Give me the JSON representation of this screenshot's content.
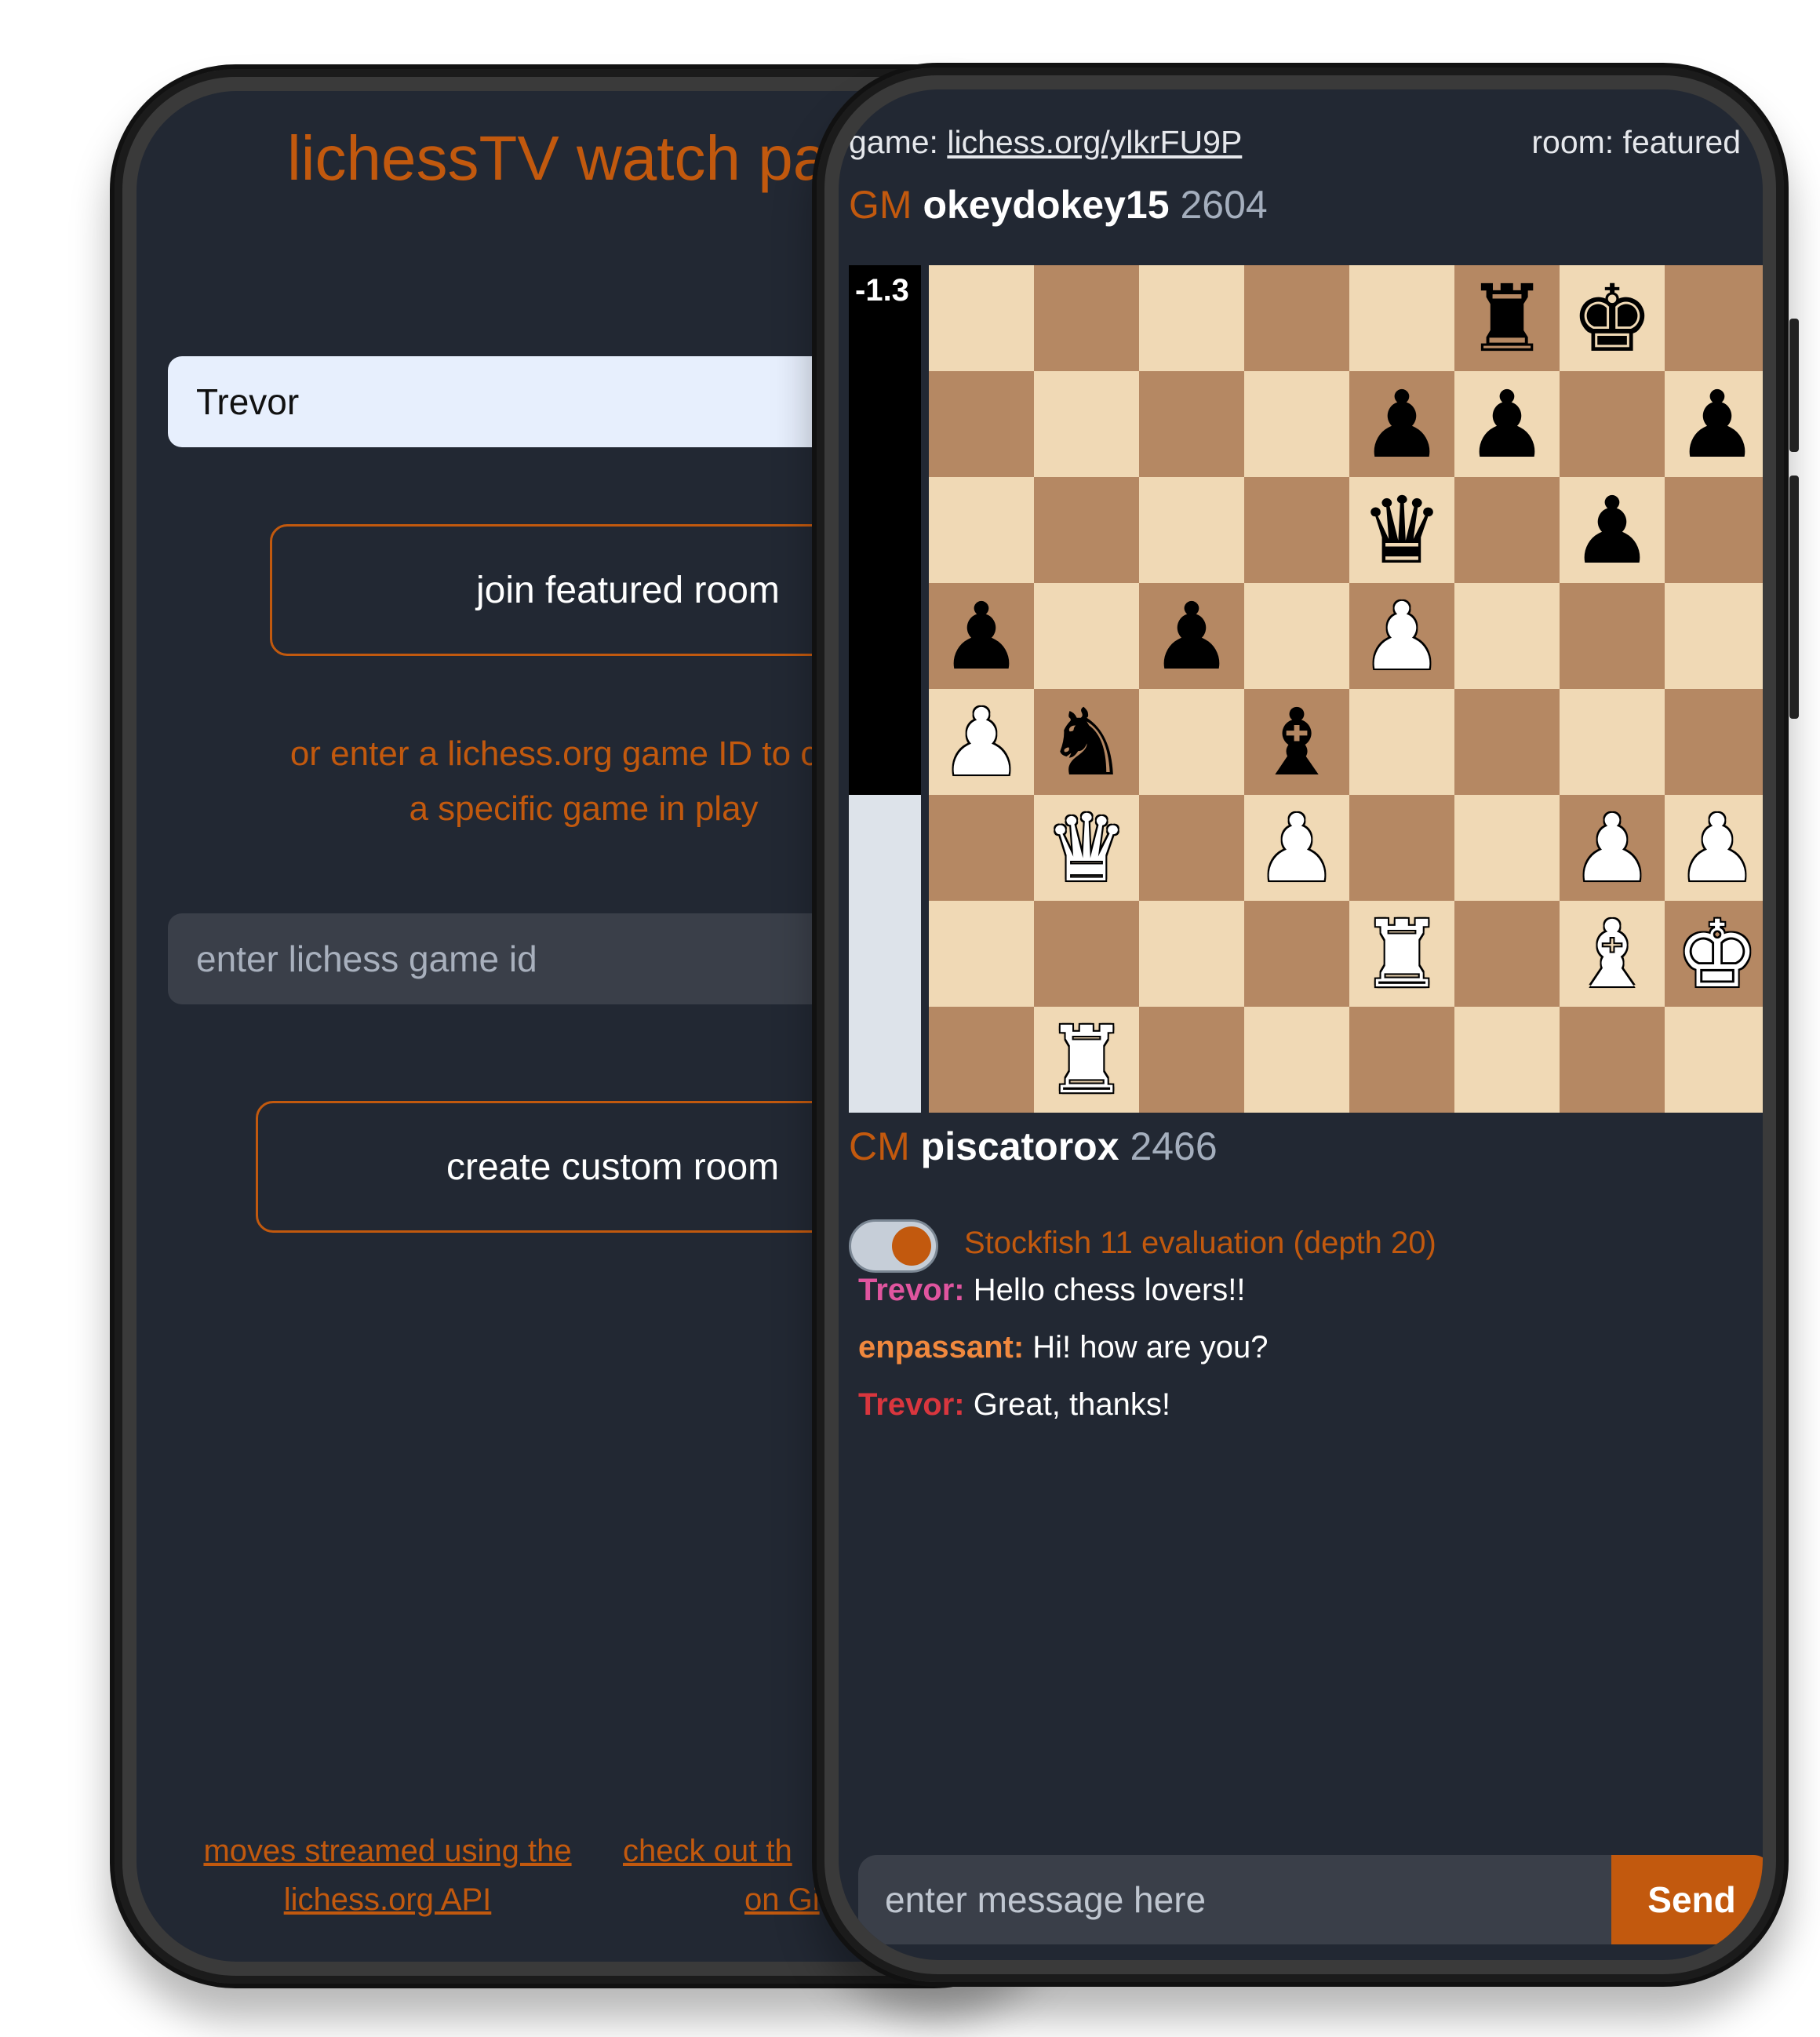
{
  "back_screen": {
    "title": "lichessTV watch pa",
    "name_input_value": "Trevor",
    "join_button": "join featured room",
    "hint_line_1": "or enter a lichess.org game ID to creat",
    "hint_line_2": "a specific game in play",
    "game_id_placeholder": "enter lichess game id",
    "custom_button": "create custom room",
    "footer_link_1_line_1": "moves streamed using the",
    "footer_link_1_line_2": "lichess.org API",
    "footer_link_2_line_1": "check out th",
    "footer_link_2_line_2": "on Gi"
  },
  "front_screen": {
    "game_label": "game:",
    "game_link": "lichess.org/ylkrFU9P",
    "room_label": "room: featured",
    "top_player": {
      "title": "GM",
      "name": "okeydokey15",
      "rating": "2604"
    },
    "bottom_player": {
      "title": "CM",
      "name": "piscatorox",
      "rating": "2466"
    },
    "evaluation": {
      "text": "-1.3",
      "black_fraction": 0.625
    },
    "board": [
      [
        "",
        "",
        "",
        "",
        "",
        "bR",
        "bK",
        ""
      ],
      [
        "",
        "",
        "",
        "",
        "bP",
        "bP",
        "",
        "bP"
      ],
      [
        "",
        "",
        "",
        "",
        "bQ",
        "",
        "bP",
        ""
      ],
      [
        "bP",
        "",
        "bP",
        "",
        "wP",
        "",
        "",
        ""
      ],
      [
        "wP",
        "bN",
        "",
        "bB",
        "",
        "",
        "",
        ""
      ],
      [
        "",
        "wQ",
        "",
        "wP",
        "",
        "",
        "wP",
        "wP"
      ],
      [
        "",
        "",
        "",
        "",
        "wR",
        "",
        "wB",
        "wK"
      ],
      [
        "",
        "wR",
        "",
        "",
        "",
        "",
        "",
        ""
      ]
    ],
    "stockfish_toggle": {
      "on": true,
      "label": "Stockfish 11 evaluation (depth 20)"
    },
    "chat": [
      {
        "user": "Trevor:",
        "text": "Hello chess lovers!!",
        "color": "#e0559f"
      },
      {
        "user": "enpassant:",
        "text": "Hi! how are you?",
        "color": "#f0883e"
      },
      {
        "user": "Trevor:",
        "text": "Great, thanks!",
        "color": "#d9363e"
      }
    ],
    "message_placeholder": "enter message here",
    "send_button": "Send"
  },
  "colors": {
    "accent": "#c2590e",
    "background": "#222833",
    "board_light": "#f0d9b5",
    "board_dark": "#b58863"
  }
}
